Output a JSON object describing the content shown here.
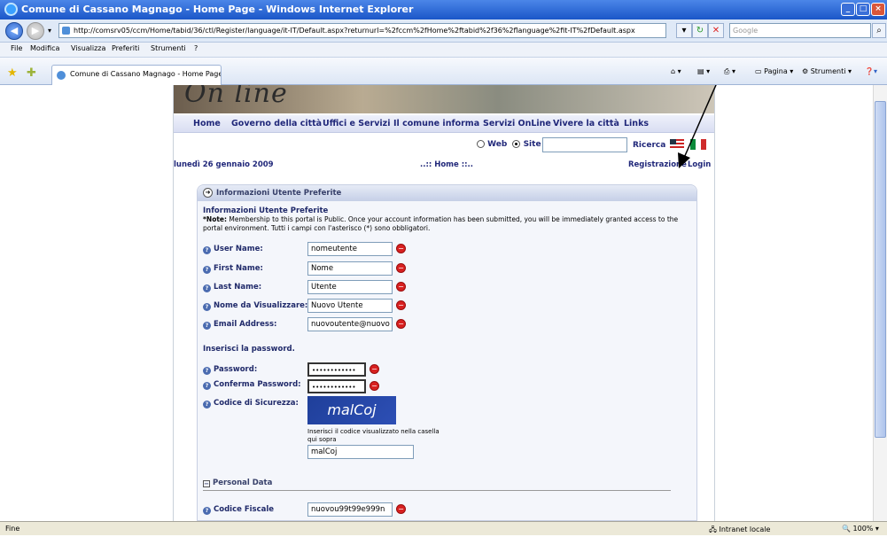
{
  "window": {
    "title": "Comune di Cassano Magnago - Home Page - Windows Internet Explorer",
    "url": "http://comsrv05/ccm/Home/tabid/36/ctl/Register/language/it-IT/Default.aspx?returnurl=%2fccm%2fHome%2ftabid%2f36%2flanguage%2fit-IT%2fDefault.aspx",
    "search_placeholder": "Google",
    "tab_label": "Comune di Cassano Magnago - Home Page"
  },
  "menu": [
    "File",
    "Modifica",
    "Visualizza",
    "Preferiti",
    "Strumenti",
    "?"
  ],
  "toolbar": {
    "pagina": "Pagina",
    "strumenti": "Strumenti"
  },
  "site": {
    "banner_text": "On line",
    "nav": [
      "Home",
      "Governo della città",
      "Uffici e Servizi",
      "Il comune informa",
      "Servizi OnLine",
      "Vivere la città",
      "Links"
    ],
    "search_web": "Web",
    "search_site": "Site",
    "search_button": "Ricerca",
    "date": "lunedì 26 gennaio 2009",
    "breadcrumb": "..:: Home ::..",
    "register_link": "Registrazione",
    "login_link": "Login"
  },
  "form": {
    "panel_title": "Informazioni Utente Preferite",
    "section_title": "Informazioni Utente Preferite",
    "note_label": "*Note:",
    "note_text": "Membership to this portal is Public. Once your account information has been submitted, you will be immediately granted access to the portal environment. Tutti i campi con l'asterisco (*) sono obbligatori.",
    "fields": [
      {
        "label": "User Name:",
        "value": "nomeutente"
      },
      {
        "label": "First Name:",
        "value": "Nome"
      },
      {
        "label": "Last Name:",
        "value": "Utente"
      },
      {
        "label": "Nome da Visualizzare:",
        "value": "Nuovo Utente"
      },
      {
        "label": "Email Address:",
        "value": "nuovoutente@nuovo"
      }
    ],
    "password_heading": "Inserisci la password.",
    "password_label": "Password:",
    "password_value": "••••••••••••",
    "confirm_label": "Conferma Password:",
    "confirm_value": "••••••••••••",
    "captcha_label": "Codice di Sicurezza:",
    "captcha_text": "malCoj",
    "captcha_hint": "Inserisci il codice visualizzato nella casella qui sopra",
    "captcha_value": "malCoj",
    "personal_heading": "Personal Data",
    "fiscal_label": "Codice Fiscale",
    "fiscal_value": "nuovou99t99e999n"
  },
  "status": {
    "left": "Fine",
    "zone": "Intranet locale",
    "zoom": "100%"
  }
}
